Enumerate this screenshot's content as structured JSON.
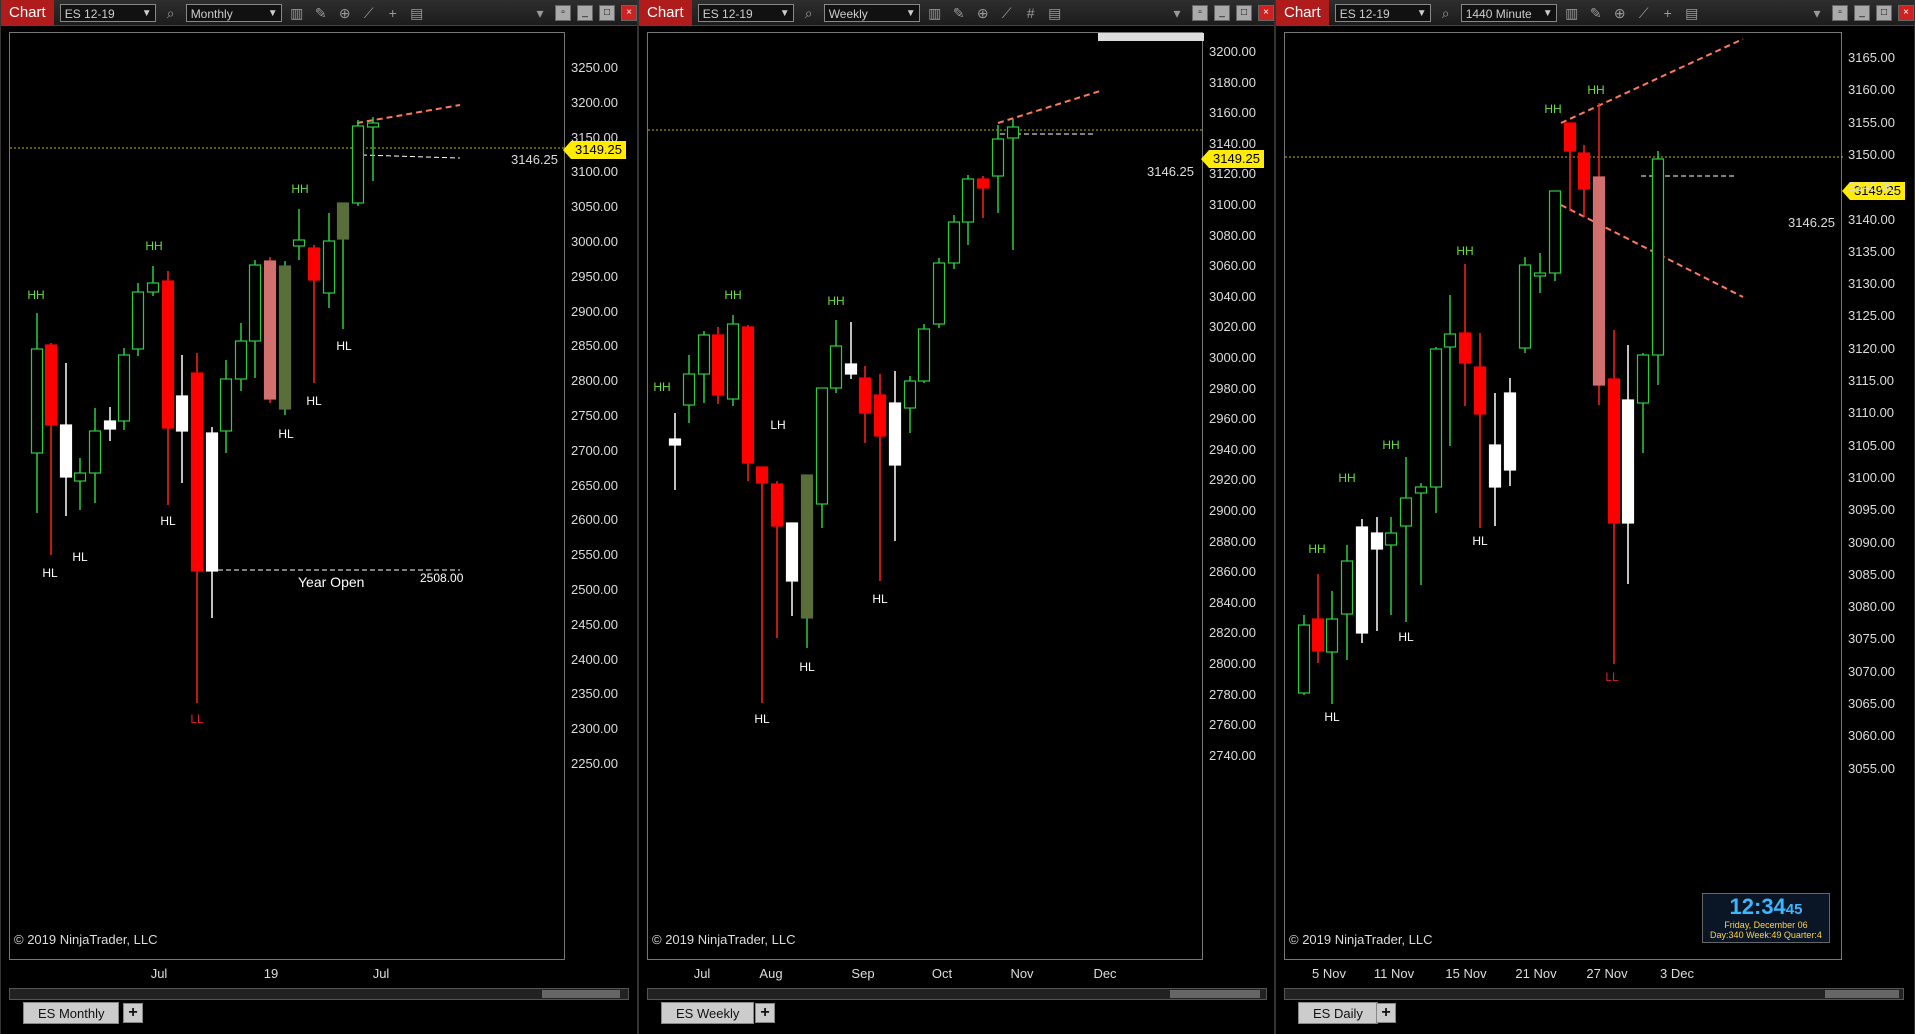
{
  "panels": [
    {
      "tab_label": "Chart",
      "instrument": "ES 12-19",
      "period": "Monthly",
      "bottom_tab": "ES  Monthly",
      "last_price": "3149.25",
      "ref_price": "3146.25",
      "copyright": "© 2019 NinjaTrader, LLC",
      "y_ticks": [
        "3250.00",
        "3200.00",
        "3150.00",
        "3100.00",
        "3050.00",
        "3000.00",
        "2950.00",
        "2900.00",
        "2850.00",
        "2800.00",
        "2750.00",
        "2700.00",
        "2650.00",
        "2600.00",
        "2550.00",
        "2500.00",
        "2450.00",
        "2400.00",
        "2350.00",
        "2300.00",
        "2250.00"
      ],
      "x_ticks": [
        "Jul",
        "19",
        "Jul"
      ],
      "annotations": [
        "HH",
        "HH",
        "HH",
        "HL",
        "HL",
        "HL",
        "HL",
        "HL",
        "HL",
        "LL"
      ],
      "year_open_label": "Year Open",
      "year_open_value": "2508.00"
    },
    {
      "tab_label": "Chart",
      "instrument": "ES 12-19",
      "period": "Weekly",
      "bottom_tab": "ES  Weekly",
      "last_price": "3149.25",
      "ref_price": "3146.25",
      "copyright": "© 2019 NinjaTrader, LLC",
      "y_ticks": [
        "3200.00",
        "3180.00",
        "3160.00",
        "3140.00",
        "3120.00",
        "3100.00",
        "3080.00",
        "3060.00",
        "3040.00",
        "3020.00",
        "3000.00",
        "2980.00",
        "2960.00",
        "2940.00",
        "2920.00",
        "2900.00",
        "2880.00",
        "2860.00",
        "2840.00",
        "2820.00",
        "2800.00",
        "2780.00",
        "2760.00",
        "2740.00"
      ],
      "x_ticks": [
        "Jul",
        "Aug",
        "Sep",
        "Oct",
        "Nov",
        "Dec"
      ],
      "annotations": [
        "HH",
        "HH",
        "HH",
        "LH",
        "HL",
        "HL",
        "HL"
      ]
    },
    {
      "tab_label": "Chart",
      "instrument": "ES 12-19",
      "period": "1440 Minute",
      "bottom_tab": "ES Daily",
      "last_price": "3149.25",
      "ref_price": "3146.25",
      "copyright": "© 2019 NinjaTrader, LLC",
      "y_ticks": [
        "3165.00",
        "3160.00",
        "3155.00",
        "3150.00",
        "3145.00",
        "3140.00",
        "3135.00",
        "3130.00",
        "3125.00",
        "3120.00",
        "3115.00",
        "3110.00",
        "3105.00",
        "3100.00",
        "3095.00",
        "3090.00",
        "3085.00",
        "3080.00",
        "3075.00",
        "3070.00",
        "3065.00",
        "3060.00",
        "3055.00"
      ],
      "x_ticks": [
        "5 Nov",
        "11 Nov",
        "15 Nov",
        "21 Nov",
        "27 Nov",
        "3 Dec"
      ],
      "annotations": [
        "HH",
        "HH",
        "HH",
        "HH",
        "HH",
        "HH",
        "HL",
        "HL",
        "HL",
        "LL"
      ],
      "clock": {
        "time": "12:34",
        "seconds": "45",
        "date": "Friday, December 06",
        "stats": "Day:340  Week:49  Quarter:4"
      }
    }
  ],
  "colors": {
    "up": "#2ecc40",
    "down": "#ff0000",
    "flag": "#ffec00",
    "hh": "#6ddc3a",
    "hl": "#ffffff",
    "ll": "#e02020",
    "trend": "#ff7a5a"
  }
}
